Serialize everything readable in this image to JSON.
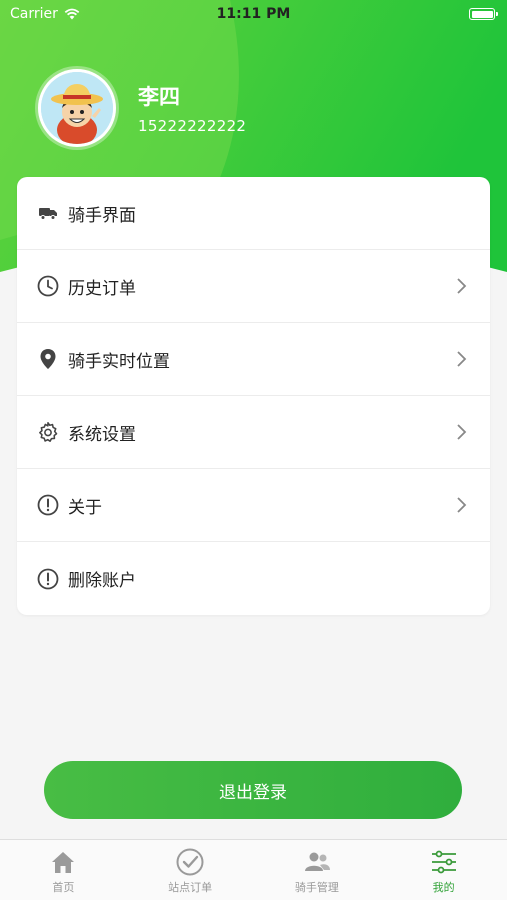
{
  "status_bar": {
    "carrier": "Carrier",
    "time": "11:11 PM"
  },
  "profile": {
    "name": "李四",
    "phone": "15222222222"
  },
  "menu": {
    "items": [
      {
        "label": "骑手界面",
        "icon": "truck-icon",
        "has_chevron": false
      },
      {
        "label": "历史订单",
        "icon": "clock-icon",
        "has_chevron": true
      },
      {
        "label": "骑手实时位置",
        "icon": "location-pin-icon",
        "has_chevron": true
      },
      {
        "label": "系统设置",
        "icon": "gear-icon",
        "has_chevron": true
      },
      {
        "label": "关于",
        "icon": "info-circle-icon",
        "has_chevron": true
      },
      {
        "label": "删除账户",
        "icon": "info-circle-icon",
        "has_chevron": false
      }
    ]
  },
  "logout_label": "退出登录",
  "tabbar": {
    "tabs": [
      {
        "label": "首页",
        "icon": "home-icon",
        "active": false
      },
      {
        "label": "站点订单",
        "icon": "check-circle-icon",
        "active": false
      },
      {
        "label": "骑手管理",
        "icon": "users-icon",
        "active": false
      },
      {
        "label": "我的",
        "icon": "sliders-icon",
        "active": true
      }
    ]
  },
  "colors": {
    "accent": "#3ab44a",
    "hero_light": "#6fd640",
    "hero_dark": "#22c63a",
    "inactive": "#999999"
  }
}
